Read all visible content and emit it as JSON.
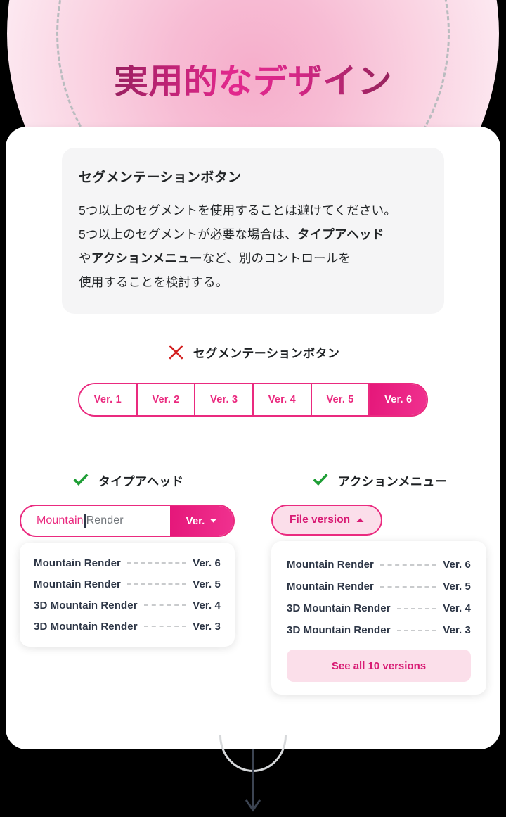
{
  "hero": {
    "title": "実用的なデザイン",
    "gradient_start": "#5f1d46",
    "gradient_mid": "#e2288d",
    "blob_color": "#f6aecb"
  },
  "description_panel": {
    "title": "セグメンテーションボタン",
    "line1": "5つ以上のセグメントを使用することは避けてください。",
    "line2_a": "5つ以上のセグメントが必要な場合は、",
    "line2_b": "タイプアヘッド",
    "line3_a": "や",
    "line3_b": "アクションメニュー",
    "line3_c": "など、別のコントロールを",
    "line4": "使用することを検討する。"
  },
  "bad_example": {
    "icon": "cross-icon",
    "icon_color": "#d32020",
    "label": "セグメンテーションボタン"
  },
  "segmented_control": {
    "accent": "#ea2a7f",
    "selected_index": 5,
    "segments": [
      {
        "label": "Ver. 1"
      },
      {
        "label": "Ver. 2"
      },
      {
        "label": "Ver. 3"
      },
      {
        "label": "Ver. 4"
      },
      {
        "label": "Ver. 5"
      },
      {
        "label": "Ver. 6"
      }
    ]
  },
  "typeahead": {
    "icon": "check-icon",
    "icon_color": "#1f9e36",
    "label": "タイプアヘッド",
    "input": {
      "typed_value": "Mountain",
      "ghost_suggestion": "Render",
      "placeholder": "Mountain Render"
    },
    "button_label": "Ver.",
    "button_icon": "chevron-down-icon",
    "results": [
      {
        "name": "Mountain Render",
        "version": "Ver. 6"
      },
      {
        "name": "Mountain Render",
        "version": "Ver. 5"
      },
      {
        "name": "3D Mountain Render",
        "version": "Ver. 4"
      },
      {
        "name": "3D Mountain Render",
        "version": "Ver. 3"
      }
    ]
  },
  "action_menu": {
    "icon": "check-icon",
    "icon_color": "#1f9e36",
    "label": "アクションメニュー",
    "trigger_label": "File version",
    "trigger_icon": "chevron-up-icon",
    "results": [
      {
        "name": "Mountain Render",
        "version": "Ver. 6"
      },
      {
        "name": "Mountain Render",
        "version": "Ver. 5"
      },
      {
        "name": "3D Mountain Render",
        "version": "Ver. 4"
      },
      {
        "name": "3D Mountain Render",
        "version": "Ver. 3"
      }
    ],
    "see_all_label": "See all 10 versions"
  },
  "footer": {
    "icon": "down-arrow-icon"
  }
}
